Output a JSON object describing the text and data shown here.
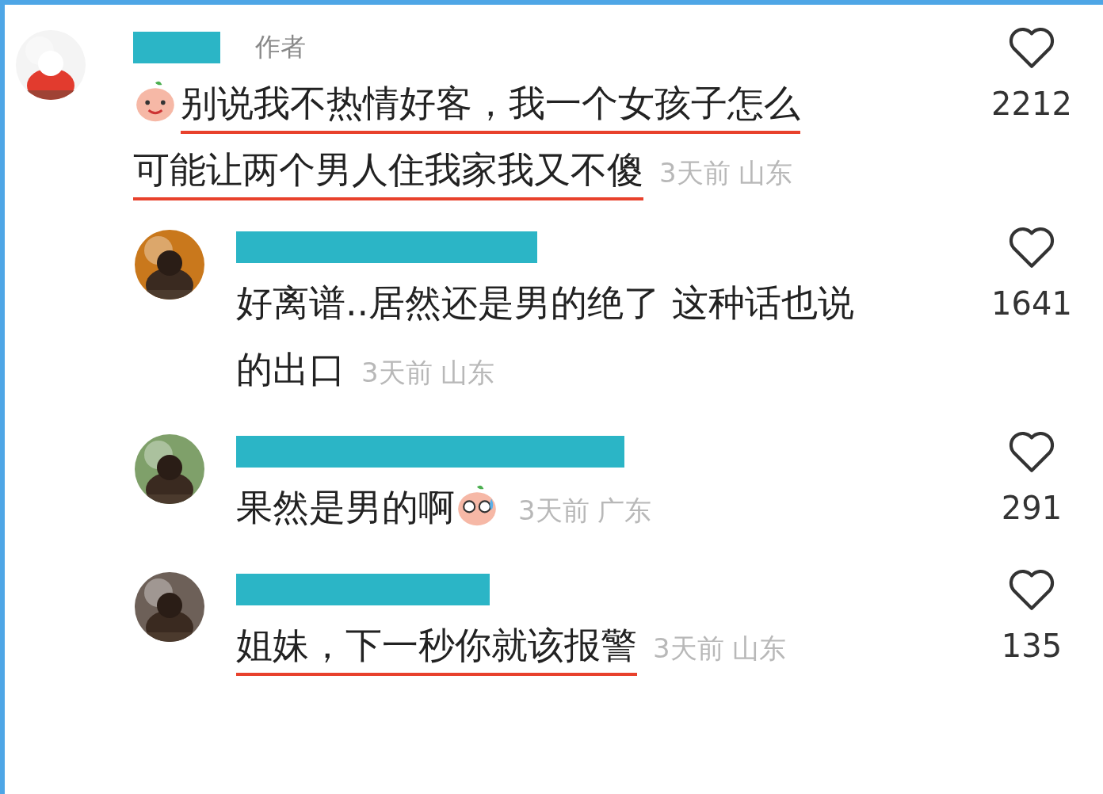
{
  "comments": [
    {
      "kind": "author",
      "tag": "作者",
      "lines": [
        "别说我不热情好客，我一个女孩子怎么",
        "可能让两个男人住我家我又不傻"
      ],
      "meta": "3天前 山东",
      "likes": "2212",
      "underlined": true
    },
    {
      "kind": "reply",
      "lines": [
        "好离谱..居然还是男的绝了 这种话也说",
        "的出口"
      ],
      "meta": "3天前 山东",
      "likes": "1641",
      "underlined": false
    },
    {
      "kind": "reply-emoji",
      "lines": [
        "果然是男的啊"
      ],
      "meta": "3天前 广东",
      "likes": "291",
      "underlined": false
    },
    {
      "kind": "reply",
      "lines": [
        "姐妹，下一秒你就该报警"
      ],
      "meta": "3天前 山东",
      "likes": "135",
      "underlined": true
    }
  ]
}
